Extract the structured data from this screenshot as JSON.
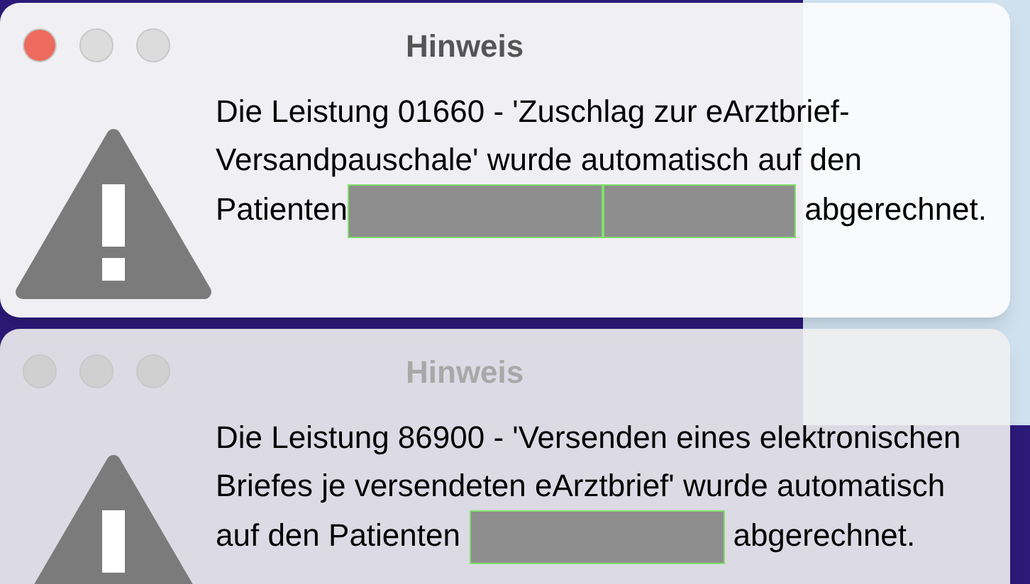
{
  "dialogs": [
    {
      "title": "Hinweis",
      "active": true,
      "message": [
        {
          "kind": "text",
          "text": "Die Leistung 01660 - 'Zuschlag zur eArztbrief-Versandpauschale' wurde automatisch auf den Patienten"
        },
        {
          "kind": "redacted_long"
        },
        {
          "kind": "redacted_short"
        },
        {
          "kind": "text",
          "text": " abgerechnet."
        }
      ]
    },
    {
      "title": "Hinweis",
      "active": false,
      "message": [
        {
          "kind": "text",
          "text": "Die Leistung 86900 - 'Versenden eines elektronischen Briefes je versendeten eArztbrief' wurde automatisch auf den Patienten "
        },
        {
          "kind": "redacted_long"
        },
        {
          "kind": "text",
          "text": " abgerechnet."
        }
      ]
    }
  ]
}
